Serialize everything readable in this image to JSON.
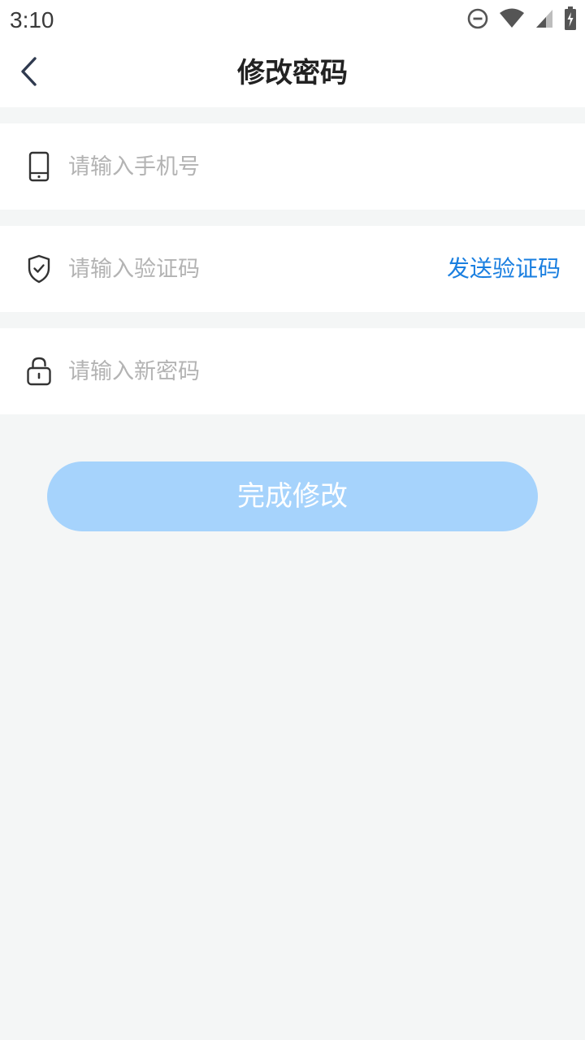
{
  "status_bar": {
    "time": "3:10",
    "icons": [
      "do-not-disturb-icon",
      "wifi-icon",
      "cellular-signal-icon",
      "battery-charging-icon"
    ]
  },
  "header": {
    "title": "修改密码",
    "back_icon": "chevron-left-icon"
  },
  "form": {
    "phone": {
      "icon": "mobile-phone-icon",
      "placeholder": "请输入手机号",
      "value": ""
    },
    "code": {
      "icon": "shield-check-icon",
      "placeholder": "请输入验证码",
      "value": "",
      "send_label": "发送验证码"
    },
    "new_password": {
      "icon": "lock-icon",
      "placeholder": "请输入新密码",
      "value": ""
    }
  },
  "submit": {
    "label": "完成修改"
  },
  "colors": {
    "accent": "#1a7fe0",
    "button_disabled": "#a6d3fc",
    "page_background": "#f4f6f6",
    "icon": "#333333"
  }
}
